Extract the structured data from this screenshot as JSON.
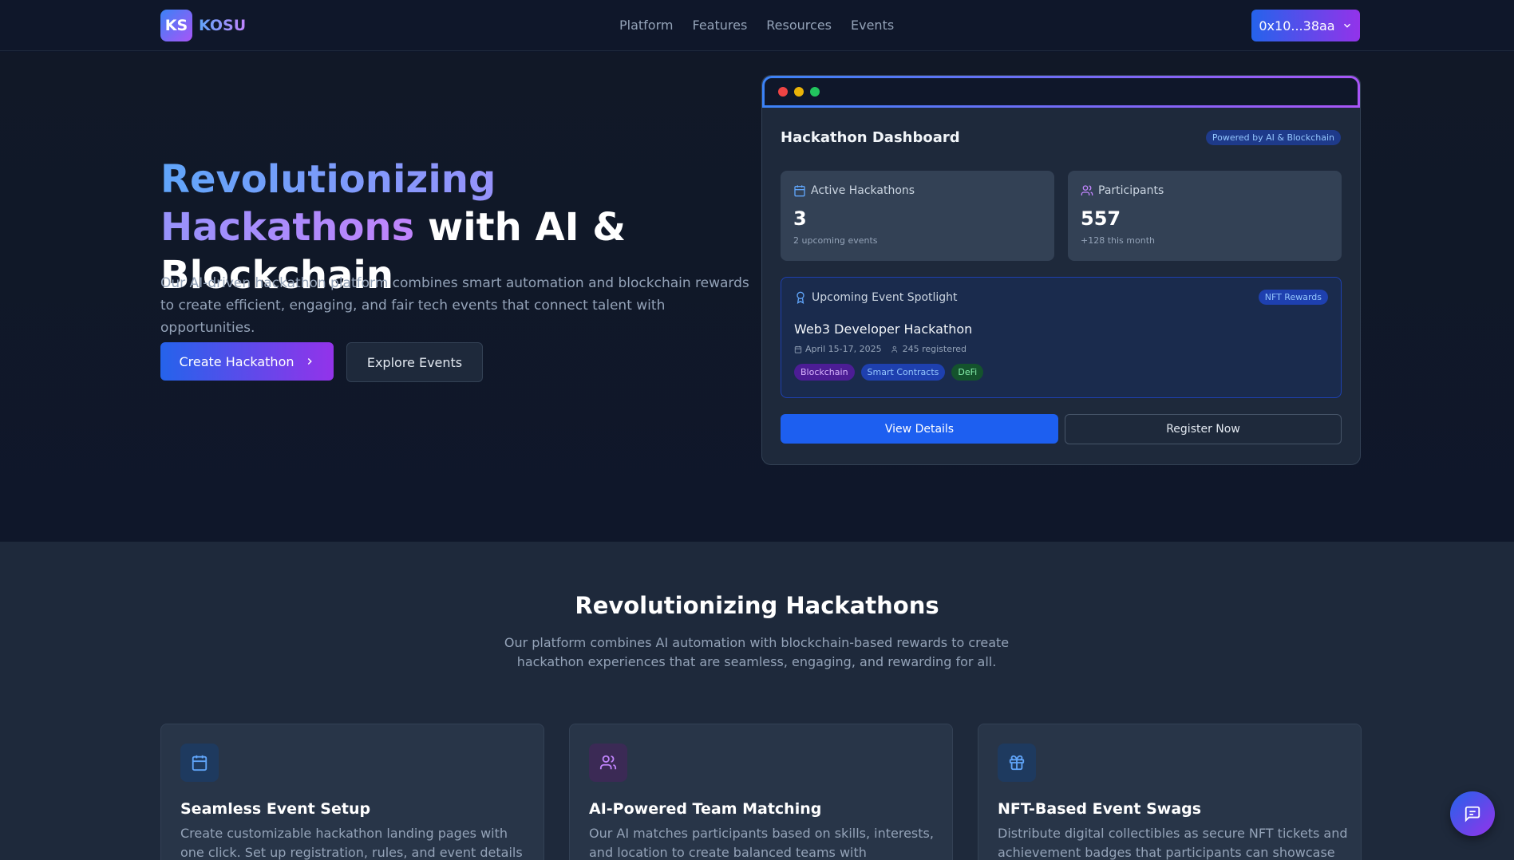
{
  "nav": {
    "logo_mark": "KS",
    "logo_text": "KOSU",
    "links": [
      "Platform",
      "Features",
      "Resources",
      "Events"
    ],
    "wallet": "0x10...38aa"
  },
  "hero": {
    "title_grad": "Revolutionizing Hackathons",
    "title_rest": " with AI & Blockchain",
    "description": "Our AI-driven hackathon platform combines smart automation and blockchain rewards to create efficient, engaging, and fair tech events that connect talent with opportunities.",
    "primary_cta": "Create Hackathon",
    "secondary_cta": "Explore Events"
  },
  "dashboard": {
    "title": "Hackathon Dashboard",
    "powered_badge": "Powered by AI & Blockchain",
    "stats": [
      {
        "label": "Active Hackathons",
        "value": "3",
        "sub": "2 upcoming events"
      },
      {
        "label": "Participants",
        "value": "557",
        "sub": "+128 this month"
      }
    ],
    "spotlight": {
      "label": "Upcoming Event Spotlight",
      "badge": "NFT Rewards",
      "event_name": "Web3 Developer Hackathon",
      "date": "April 15-17, 2025",
      "registered": "245 registered",
      "tags": [
        "Blockchain",
        "Smart Contracts",
        "DeFi"
      ]
    },
    "view_button": "View Details",
    "register_button": "Register Now"
  },
  "features": {
    "title": "Revolutionizing Hackathons",
    "description": "Our platform combines AI automation with blockchain-based rewards to create hackathon experiences that are seamless, engaging, and rewarding for all.",
    "cards": [
      {
        "title": "Seamless Event Setup",
        "description": "Create customizable hackathon landing pages with one click. Set up registration, rules, and event details in minutes, not"
      },
      {
        "title": "AI-Powered Team Matching",
        "description": "Our AI matches participants based on skills, interests, and location to create balanced teams with complementary"
      },
      {
        "title": "NFT-Based Event Swags",
        "description": "Distribute digital collectibles as secure NFT tickets and achievement badges that participants can showcase and use"
      }
    ]
  },
  "colors": {
    "background": "#0f172a",
    "accent_blue": "#2563eb",
    "accent_purple": "#9333ea"
  }
}
